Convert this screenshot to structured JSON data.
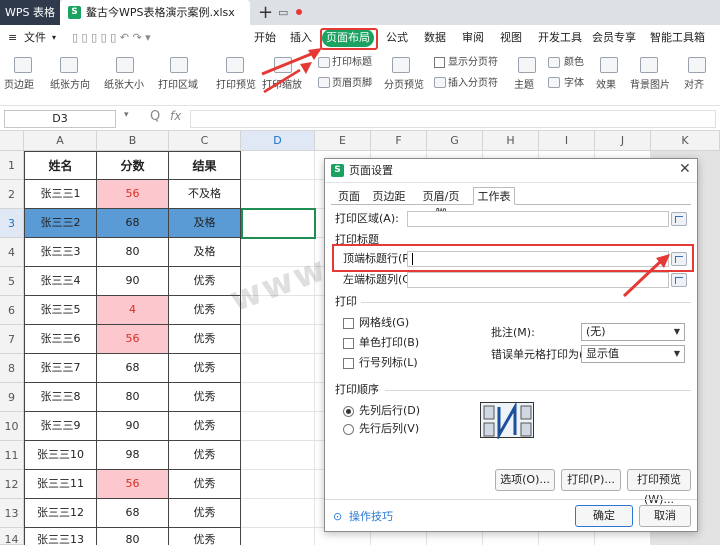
{
  "titlebar": {
    "app": "WPS 表格",
    "doc_icon": "S",
    "doc_name": "鳌古今WPS表格演示案例.xlsx",
    "new_tab": "+"
  },
  "menubar": {
    "file": "文件",
    "items": [
      "开始",
      "插入",
      "页面布局",
      "公式",
      "数据",
      "审阅",
      "视图",
      "开发工具",
      "会员专享",
      "智能工具箱"
    ],
    "active": "页面布局"
  },
  "ribbon": {
    "items": [
      "页边距",
      "纸张方向",
      "纸张大小",
      "打印区域",
      "打印预览",
      "打印缩放",
      "打印标题",
      "页眉页脚",
      "分页预览",
      "显示分页符",
      "插入分页符",
      "主题",
      "颜色",
      "字体",
      "效果",
      "背景图片",
      "对齐"
    ]
  },
  "formula": {
    "cell_ref": "D3",
    "fx": "fx",
    "zoom": "Q"
  },
  "sheet": {
    "columns": [
      "A",
      "B",
      "C",
      "D",
      "E",
      "F",
      "G",
      "H",
      "I",
      "J",
      "K"
    ],
    "rows": [
      "1",
      "2",
      "3",
      "4",
      "5",
      "6",
      "7",
      "8",
      "9",
      "10",
      "11",
      "12",
      "13",
      "14"
    ],
    "header": [
      "姓名",
      "分数",
      "结果"
    ],
    "data": [
      [
        "张三三1",
        "56",
        "不及格"
      ],
      [
        "张三三2",
        "68",
        "及格"
      ],
      [
        "张三三3",
        "80",
        "及格"
      ],
      [
        "张三三4",
        "90",
        "优秀"
      ],
      [
        "张三三5",
        "4",
        "优秀"
      ],
      [
        "张三三6",
        "56",
        "优秀"
      ],
      [
        "张三三7",
        "68",
        "优秀"
      ],
      [
        "张三三8",
        "80",
        "优秀"
      ],
      [
        "张三三9",
        "90",
        "优秀"
      ],
      [
        "张三三10",
        "98",
        "优秀"
      ],
      [
        "张三三11",
        "56",
        "优秀"
      ],
      [
        "张三三12",
        "68",
        "优秀"
      ],
      [
        "张三三13",
        "80",
        "优秀"
      ]
    ]
  },
  "watermark": "www.yjqrjin.cn",
  "dialog": {
    "title": "页面设置",
    "close": "✕",
    "tabs": [
      "页面",
      "页边距",
      "页眉/页脚",
      "工作表"
    ],
    "print_area_label": "打印区域(A):",
    "print_titles_label": "打印标题",
    "top_rows_label": "顶端标题行(R):",
    "left_cols_label": "左端标题列(C):",
    "print_label": "打印",
    "gridlines": "网格线(G)",
    "mono": "单色打印(B)",
    "row_col_headers": "行号列标(L)",
    "comments_label": "批注(M):",
    "comments_value": "(无)",
    "errors_label": "错误单元格打印为(E):",
    "errors_value": "显示值",
    "order_label": "打印顺序",
    "down_then_over": "先列后行(D)",
    "over_then_down": "先行后列(V)",
    "options_btn": "选项(O)...",
    "print_btn": "打印(P)...",
    "preview_btn": "打印预览(W)...",
    "tips": "操作技巧",
    "ok": "确定",
    "cancel": "取消"
  },
  "colors": {
    "accent": "#1aa260",
    "highlight": "#e53935",
    "pink": "#fcc8ce",
    "selected_row": "#5b9bd5"
  }
}
